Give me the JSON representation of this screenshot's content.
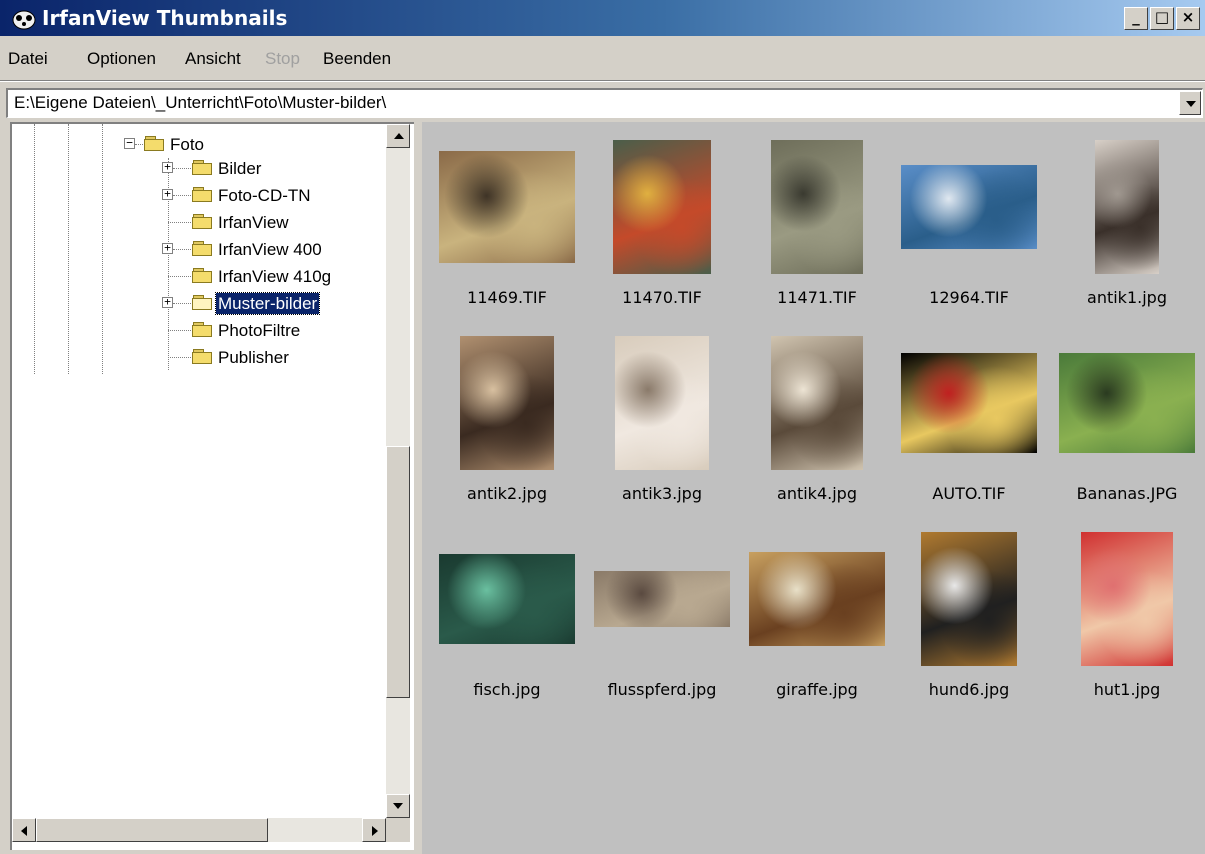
{
  "window": {
    "title": "IrfanView Thumbnails",
    "minimize": "_",
    "maximize": "□",
    "close": "×"
  },
  "menu": [
    {
      "label": "Datei",
      "enabled": true
    },
    {
      "label": "Optionen",
      "enabled": true
    },
    {
      "label": "Ansicht",
      "enabled": true
    },
    {
      "label": "Stop",
      "enabled": false
    },
    {
      "label": "Beenden",
      "enabled": true
    }
  ],
  "path": {
    "value": "E:\\Eigene Dateien\\_Unterricht\\Foto\\Muster-bilder\\"
  },
  "tree": {
    "root": {
      "label": "Foto",
      "expander": "−"
    },
    "children": [
      {
        "label": "Bilder",
        "expander": "+"
      },
      {
        "label": "Foto-CD-TN",
        "expander": "+"
      },
      {
        "label": "IrfanView",
        "expander": ""
      },
      {
        "label": "IrfanView 400",
        "expander": "+"
      },
      {
        "label": "IrfanView 410g",
        "expander": ""
      },
      {
        "label": "Muster-bilder",
        "expander": "+",
        "selected": true
      },
      {
        "label": "PhotoFiltre",
        "expander": ""
      },
      {
        "label": "Publisher",
        "expander": ""
      }
    ]
  },
  "thumbnails": [
    {
      "name": "11469.TIF",
      "colors": [
        "#8a6a48",
        "#c9b37e",
        "#3e3326"
      ]
    },
    {
      "name": "11470.TIF",
      "colors": [
        "#4a5e4a",
        "#c44a2a",
        "#e0b040"
      ]
    },
    {
      "name": "11471.TIF",
      "colors": [
        "#6e6e5a",
        "#9a9a82",
        "#3a3a30"
      ]
    },
    {
      "name": "12964.TIF",
      "colors": [
        "#5a8ec8",
        "#2a5e8a",
        "#e0e8f0"
      ]
    },
    {
      "name": "antik1.jpg",
      "colors": [
        "#d8d0c8",
        "#3a302a",
        "#a09890"
      ]
    },
    {
      "name": "antik2.jpg",
      "colors": [
        "#b09070",
        "#3a2a20",
        "#d8c0a0"
      ]
    },
    {
      "name": "antik3.jpg",
      "colors": [
        "#d8ccbc",
        "#f0e8e0",
        "#8a7a6a"
      ]
    },
    {
      "name": "antik4.jpg",
      "colors": [
        "#d0c4b0",
        "#5a4a3a",
        "#ede4d4"
      ]
    },
    {
      "name": "AUTO.TIF",
      "colors": [
        "#000000",
        "#e8c860",
        "#c02020"
      ]
    },
    {
      "name": "Bananas.JPG",
      "colors": [
        "#4a7a3a",
        "#8ab050",
        "#2a3a20"
      ]
    },
    {
      "name": "fisch.jpg",
      "colors": [
        "#1a3a30",
        "#2a5a4a",
        "#6ac0a0"
      ]
    },
    {
      "name": "flusspferd.jpg",
      "colors": [
        "#8a7a68",
        "#b8a890",
        "#5a4a40"
      ]
    },
    {
      "name": "giraffe.jpg",
      "colors": [
        "#c8a060",
        "#6a4020",
        "#e8e0c8"
      ]
    },
    {
      "name": "hund6.jpg",
      "colors": [
        "#b07a30",
        "#202020",
        "#e8e8e8"
      ]
    },
    {
      "name": "hut1.jpg",
      "colors": [
        "#d03030",
        "#f0c8a8",
        "#e07070"
      ]
    }
  ]
}
